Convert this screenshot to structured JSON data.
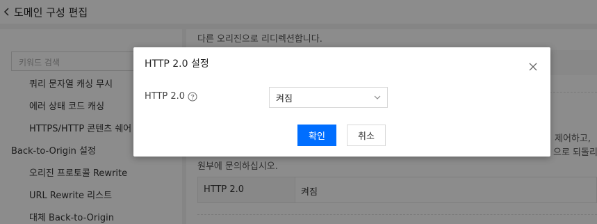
{
  "header": {
    "back_icon": "chevron-left-icon",
    "title": "도메인 구성 편집"
  },
  "sidebar": {
    "search_placeholder": "키워드 검색",
    "items": [
      "쿼리 문자열 캐싱 무시",
      "에러 상태 코드 캐싱",
      "HTTPS/HTTP 콘텐츠 쉐어"
    ],
    "group_title": "Back-to-Origin 설정",
    "group_items": [
      "오리진 프로토콜 Rewrite",
      "URL Rewrite 리스트",
      "대체 Back-to-Origin"
    ]
  },
  "main": {
    "top_text": "다른 오리진으로 리디렉션합니다.",
    "right_text_1": "제어하고, ",
    "right_text_2": "으로 되돌리",
    "bottom_text": "원부에 문의하십시오.",
    "table": {
      "header": "HTTP 2.0",
      "value": "켜짐"
    }
  },
  "dialog": {
    "title": "HTTP 2.0 설정",
    "close_icon": "close-icon",
    "field_label": "HTTP 2.0",
    "help_icon": "help-circle-icon",
    "select_value": "켜짐",
    "confirm_label": "확인",
    "cancel_label": "취소"
  },
  "colors": {
    "primary": "#006eff",
    "overlay": "rgba(0,0,0,0.45)"
  }
}
